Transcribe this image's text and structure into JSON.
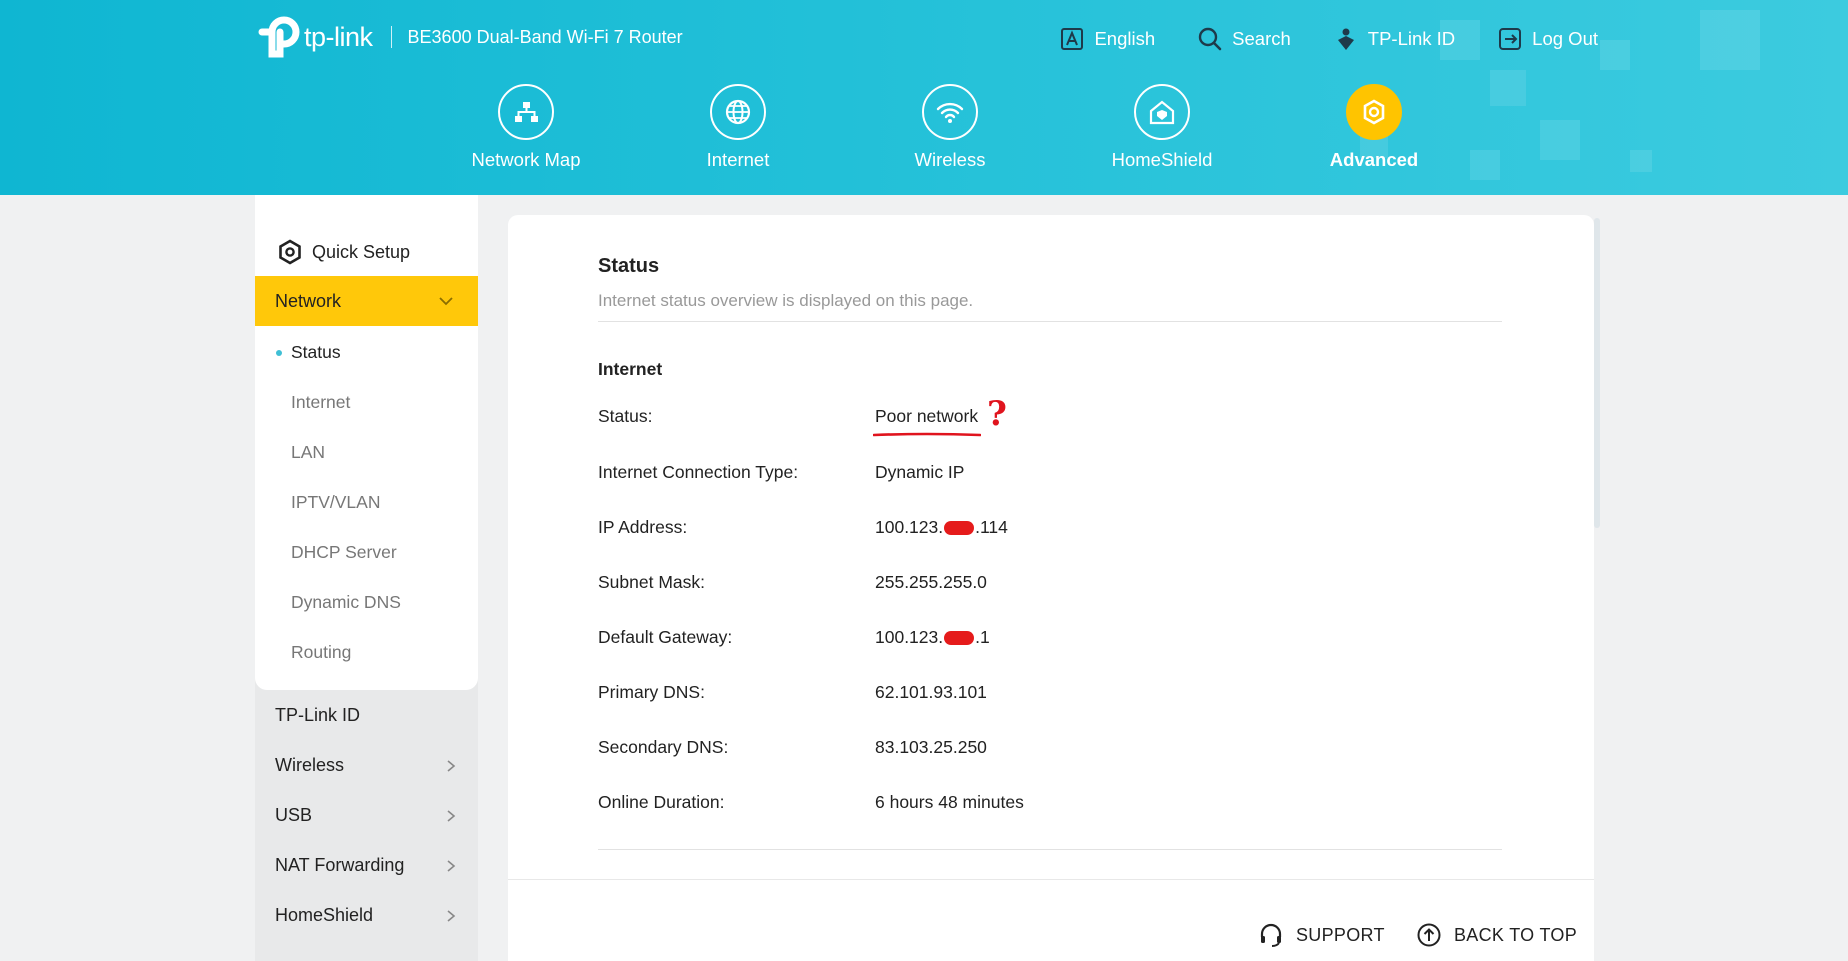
{
  "header": {
    "logo_text": "tp-link",
    "model": "BE3600 Dual-Band Wi-Fi 7 Router",
    "top_links": [
      {
        "label": "English",
        "icon": "language-icon"
      },
      {
        "label": "Search",
        "icon": "search-icon"
      },
      {
        "label": "TP-Link ID",
        "icon": "tplink-id-icon"
      },
      {
        "label": "Log Out",
        "icon": "logout-icon"
      }
    ],
    "main_tabs": [
      {
        "label": "Network Map",
        "icon": "network-map-icon",
        "active": false
      },
      {
        "label": "Internet",
        "icon": "globe-icon",
        "active": false
      },
      {
        "label": "Wireless",
        "icon": "wifi-icon",
        "active": false
      },
      {
        "label": "HomeShield",
        "icon": "homeshield-icon",
        "active": false
      },
      {
        "label": "Advanced",
        "icon": "gear-icon",
        "active": true
      }
    ]
  },
  "sidebar": {
    "quick_setup": "Quick Setup",
    "network": "Network",
    "network_sub": [
      "Status",
      "Internet",
      "LAN",
      "IPTV/VLAN",
      "DHCP Server",
      "Dynamic DNS",
      "Routing"
    ],
    "items": [
      "TP-Link ID",
      "Wireless",
      "USB",
      "NAT Forwarding",
      "HomeShield"
    ]
  },
  "main": {
    "title": "Status",
    "subtitle": "Internet status overview is displayed on this page.",
    "section": "Internet",
    "rows": [
      {
        "label": "Status:",
        "value": "Poor network"
      },
      {
        "label": "Internet Connection Type:",
        "value": "Dynamic IP"
      },
      {
        "label": "IP Address:",
        "value_prefix": "100.123.",
        "value_suffix": ".114"
      },
      {
        "label": "Subnet Mask:",
        "value": "255.255.255.0"
      },
      {
        "label": "Default Gateway:",
        "value_prefix": "100.123.",
        "value_suffix": ".1"
      },
      {
        "label": "Primary DNS:",
        "value": "62.101.93.101"
      },
      {
        "label": "Secondary DNS:",
        "value": "83.103.25.250"
      },
      {
        "label": "Online Duration:",
        "value": "6 hours 48 minutes"
      }
    ],
    "annotation_mark": "?"
  },
  "footer": {
    "support": "SUPPORT",
    "back_to_top": "BACK TO TOP"
  },
  "colors": {
    "header": "#22c0d8",
    "accent": "#ffc80a",
    "annotation": "#e0141e"
  }
}
